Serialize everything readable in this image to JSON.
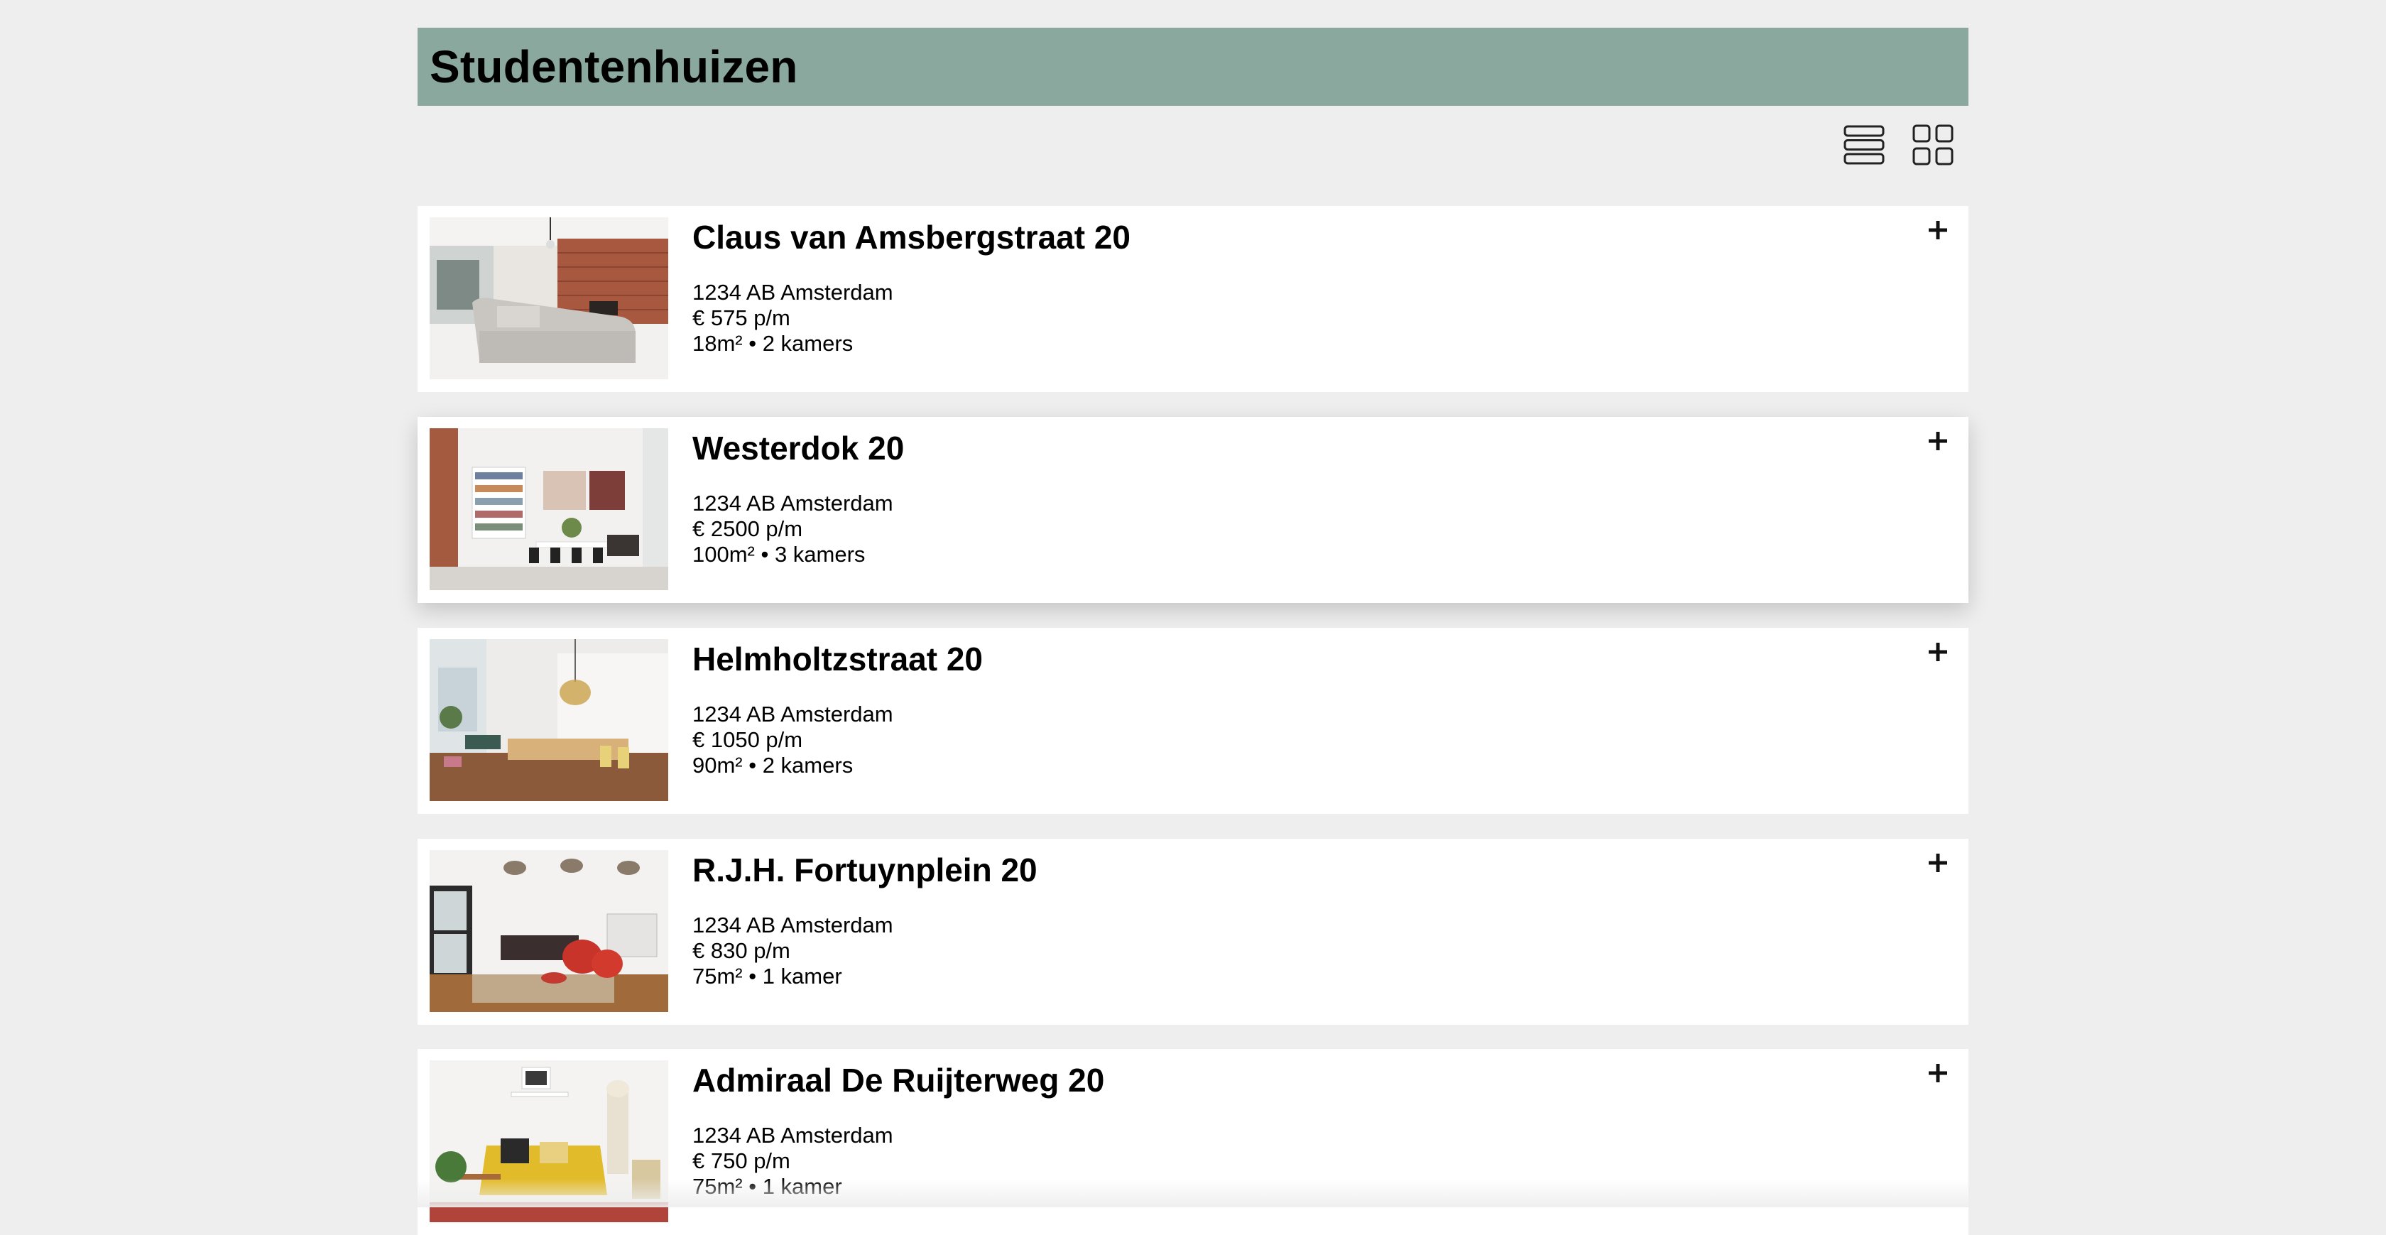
{
  "page": {
    "title": "Studentenhuizen",
    "header_color": "#8aa89d",
    "background_color": "#eeeeee"
  },
  "view_toggle": {
    "list_icon": "list-view-icon",
    "grid_icon": "grid-view-icon"
  },
  "listings": [
    {
      "title": "Claus van Amsbergstraat 20",
      "address": "1234 AB Amsterdam",
      "price": "€ 575 p/m",
      "details": "18m² • 2 kamers",
      "icon": "plus-icon"
    },
    {
      "title": "Westerdok 20",
      "address": "1234 AB Amsterdam",
      "price": "€ 2500 p/m",
      "details": "100m² • 3 kamers",
      "icon": "plus-icon"
    },
    {
      "title": "Helmholtzstraat 20",
      "address": "1234 AB Amsterdam",
      "price": "€ 1050 p/m",
      "details": "90m² • 2 kamers",
      "icon": "plus-icon"
    },
    {
      "title": "R.J.H. Fortuynplein 20",
      "address": "1234 AB Amsterdam",
      "price": "€ 830 p/m",
      "details": "75m² • 1 kamer",
      "icon": "plus-icon"
    },
    {
      "title": "Admiraal De Ruijterweg 20",
      "address": "1234 AB Amsterdam",
      "price": "€ 750 p/m",
      "details": "75m² • 1 kamer",
      "icon": "plus-icon"
    }
  ]
}
